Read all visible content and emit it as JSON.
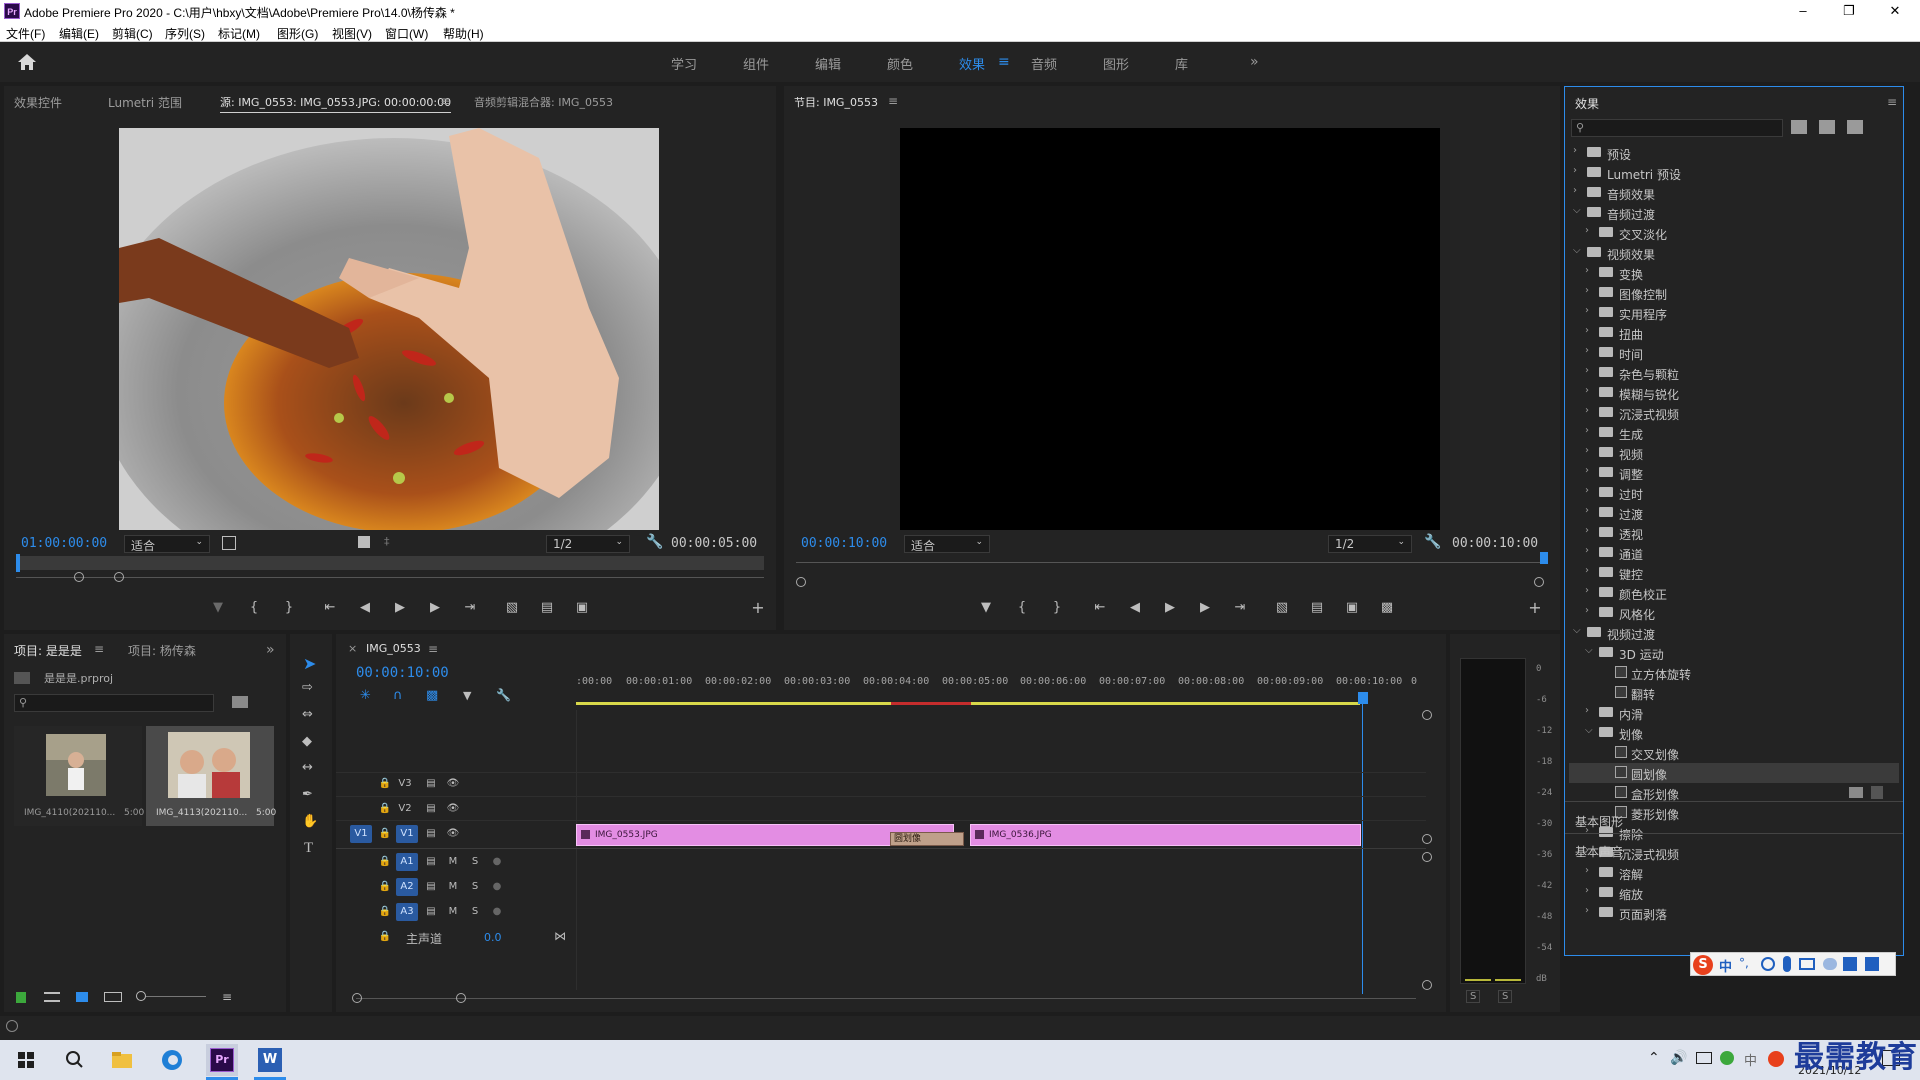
{
  "window": {
    "title": "Adobe Premiere Pro 2020 - C:\\用户\\hbxy\\文档\\Adobe\\Premiere Pro\\14.0\\杨传森 *",
    "logo": "Pr"
  },
  "menu": [
    "文件(F)",
    "编辑(E)",
    "剪辑(C)",
    "序列(S)",
    "标记(M)",
    "图形(G)",
    "视图(V)",
    "窗口(W)",
    "帮助(H)"
  ],
  "workspaces": [
    {
      "label": "学习",
      "active": false
    },
    {
      "label": "组件",
      "active": false
    },
    {
      "label": "编辑",
      "active": false
    },
    {
      "label": "颜色",
      "active": false
    },
    {
      "label": "效果",
      "active": true
    },
    {
      "label": "音频",
      "active": false
    },
    {
      "label": "图形",
      "active": false
    },
    {
      "label": "库",
      "active": false
    }
  ],
  "source_panel": {
    "tabs": [
      "效果控件",
      "Lumetri 范围",
      "源: IMG_0553: IMG_0553.JPG: 00:00:00:00",
      "音频剪辑混合器: IMG_0553"
    ],
    "active_tab": 2,
    "timecode": "01:00:00:00",
    "fit": "适合",
    "resolution": "1/2",
    "duration": "00:00:05:00"
  },
  "program_panel": {
    "tab": "节目: IMG_0553",
    "timecode": "00:00:10:00",
    "fit": "适合",
    "resolution": "1/2",
    "duration": "00:00:10:00"
  },
  "effects_panel": {
    "title": "效果",
    "search_placeholder": "",
    "items": [
      {
        "label": "预设",
        "level": 0,
        "type": "folder",
        "expanded": false,
        "special": true
      },
      {
        "label": "Lumetri 预设",
        "level": 0,
        "type": "folder",
        "expanded": false,
        "special": true
      },
      {
        "label": "音频效果",
        "level": 0,
        "type": "folder",
        "expanded": false
      },
      {
        "label": "音频过渡",
        "level": 0,
        "type": "folder",
        "expanded": true
      },
      {
        "label": "交叉淡化",
        "level": 1,
        "type": "folder",
        "expanded": false
      },
      {
        "label": "视频效果",
        "level": 0,
        "type": "folder",
        "expanded": true
      },
      {
        "label": "变换",
        "level": 1,
        "type": "folder",
        "expanded": false
      },
      {
        "label": "图像控制",
        "level": 1,
        "type": "folder",
        "expanded": false
      },
      {
        "label": "实用程序",
        "level": 1,
        "type": "folder",
        "expanded": false
      },
      {
        "label": "扭曲",
        "level": 1,
        "type": "folder",
        "expanded": false
      },
      {
        "label": "时间",
        "level": 1,
        "type": "folder",
        "expanded": false
      },
      {
        "label": "杂色与颗粒",
        "level": 1,
        "type": "folder",
        "expanded": false
      },
      {
        "label": "模糊与锐化",
        "level": 1,
        "type": "folder",
        "expanded": false
      },
      {
        "label": "沉浸式视频",
        "level": 1,
        "type": "folder",
        "expanded": false
      },
      {
        "label": "生成",
        "level": 1,
        "type": "folder",
        "expanded": false
      },
      {
        "label": "视频",
        "level": 1,
        "type": "folder",
        "expanded": false
      },
      {
        "label": "调整",
        "level": 1,
        "type": "folder",
        "expanded": false
      },
      {
        "label": "过时",
        "level": 1,
        "type": "folder",
        "expanded": false
      },
      {
        "label": "过渡",
        "level": 1,
        "type": "folder",
        "expanded": false
      },
      {
        "label": "透视",
        "level": 1,
        "type": "folder",
        "expanded": false
      },
      {
        "label": "通道",
        "level": 1,
        "type": "folder",
        "expanded": false
      },
      {
        "label": "键控",
        "level": 1,
        "type": "folder",
        "expanded": false
      },
      {
        "label": "颜色校正",
        "level": 1,
        "type": "folder",
        "expanded": false
      },
      {
        "label": "风格化",
        "level": 1,
        "type": "folder",
        "expanded": false
      },
      {
        "label": "视频过渡",
        "level": 0,
        "type": "folder",
        "expanded": true
      },
      {
        "label": "3D 运动",
        "level": 1,
        "type": "folder",
        "expanded": true
      },
      {
        "label": "立方体旋转",
        "level": 2,
        "type": "effect"
      },
      {
        "label": "翻转",
        "level": 2,
        "type": "effect"
      },
      {
        "label": "内滑",
        "level": 1,
        "type": "folder",
        "expanded": false
      },
      {
        "label": "划像",
        "level": 1,
        "type": "folder",
        "expanded": true
      },
      {
        "label": "交叉划像",
        "level": 2,
        "type": "effect"
      },
      {
        "label": "圆划像",
        "level": 2,
        "type": "effect",
        "selected": true
      },
      {
        "label": "盒形划像",
        "level": 2,
        "type": "effect"
      },
      {
        "label": "菱形划像",
        "level": 2,
        "type": "effect"
      },
      {
        "label": "擦除",
        "level": 1,
        "type": "folder",
        "expanded": false
      },
      {
        "label": "沉浸式视频",
        "level": 1,
        "type": "folder",
        "expanded": false
      },
      {
        "label": "溶解",
        "level": 1,
        "type": "folder",
        "expanded": false
      },
      {
        "label": "缩放",
        "level": 1,
        "type": "folder",
        "expanded": false
      },
      {
        "label": "页面剥落",
        "level": 1,
        "type": "folder",
        "expanded": false
      }
    ],
    "bottom_panels": [
      "基本图形",
      "基本声音"
    ]
  },
  "project_panel": {
    "tabs": [
      "项目: 是是是",
      "项目: 杨传森"
    ],
    "file": "是是是.prproj",
    "items": [
      {
        "name": "IMG_4110(202110...",
        "duration": "5:00"
      },
      {
        "name": "IMG_4113(202110...",
        "duration": "5:00"
      }
    ]
  },
  "timeline": {
    "tab": "IMG_0553",
    "timecode": "00:00:10:00",
    "ruler": [
      ":00:00",
      "00:00:01:00",
      "00:00:02:00",
      "00:00:03:00",
      "00:00:04:00",
      "00:00:05:00",
      "00:00:06:00",
      "00:00:07:00",
      "00:00:08:00",
      "00:00:09:00",
      "00:00:10:00",
      "0"
    ],
    "video_tracks": [
      "V3",
      "V2",
      "V1"
    ],
    "audio_tracks": [
      "A1",
      "A2",
      "A3"
    ],
    "master": {
      "label": "主声道",
      "value": "0.0"
    },
    "source_patch": "V1",
    "track_buttons": {
      "mute": "M",
      "solo": "S"
    },
    "clips": [
      {
        "name": "IMG_0553.JPG",
        "track": "V1"
      },
      {
        "name": "IMG_0536.JPG",
        "track": "V1"
      }
    ],
    "transition": "圆划像"
  },
  "audio_meter": {
    "ticks": [
      "0",
      "-6",
      "-12",
      "-18",
      "-24",
      "-30",
      "-36",
      "-42",
      "-48",
      "-54",
      "dB"
    ],
    "solo": [
      "S",
      "S"
    ]
  },
  "ime_bar": [
    "中",
    "°,"
  ],
  "taskbar": {
    "date": "2021/10/12",
    "watermark": "最需教育"
  }
}
